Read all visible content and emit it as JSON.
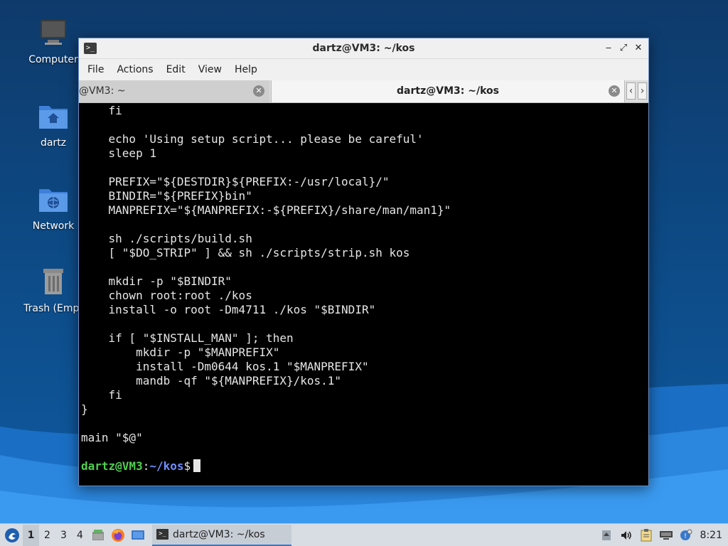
{
  "desktop": {
    "icons": [
      {
        "label": "Computer"
      },
      {
        "label": "dartz"
      },
      {
        "label": "Network"
      },
      {
        "label": "Trash (Empt"
      }
    ]
  },
  "window": {
    "title": "dartz@VM3: ~/kos",
    "app_icon": ">_",
    "controls": {
      "minimize": "‒",
      "maximize": "⤢",
      "close": "✕"
    },
    "menu": [
      "File",
      "Actions",
      "Edit",
      "View",
      "Help"
    ],
    "tabs": [
      {
        "label": "@VM3: ~",
        "active": false
      },
      {
        "label": "dartz@VM3: ~/kos",
        "active": true
      }
    ],
    "tab_close_glyph": "✕",
    "tab_scroll": {
      "left": "‹",
      "right": "›"
    }
  },
  "terminal": {
    "lines": [
      "    fi",
      "",
      "    echo 'Using setup script... please be careful'",
      "    sleep 1",
      "",
      "    PREFIX=\"${DESTDIR}${PREFIX:-/usr/local}/\"",
      "    BINDIR=\"${PREFIX}bin\"",
      "    MANPREFIX=\"${MANPREFIX:-${PREFIX}/share/man/man1}\"",
      "",
      "    sh ./scripts/build.sh",
      "    [ \"$DO_STRIP\" ] && sh ./scripts/strip.sh kos",
      "",
      "    mkdir -p \"$BINDIR\"",
      "    chown root:root ./kos",
      "    install -o root -Dm4711 ./kos \"$BINDIR\"",
      "",
      "    if [ \"$INSTALL_MAN\" ]; then",
      "        mkdir -p \"$MANPREFIX\"",
      "        install -Dm0644 kos.1 \"$MANPREFIX\"",
      "        mandb -qf \"${MANPREFIX}/kos.1\"",
      "    fi",
      "}",
      "",
      "main \"$@\"",
      ""
    ],
    "prompt": {
      "user_host": "dartz@VM3",
      "sep": ":",
      "path": "~/kos",
      "symbol": "$"
    }
  },
  "taskbar": {
    "workspaces": [
      "1",
      "2",
      "3",
      "4"
    ],
    "active_workspace": "1",
    "launchers": [
      "file-manager-icon",
      "firefox-icon",
      "desktop-icon"
    ],
    "task": {
      "icon": ">_",
      "label": "dartz@VM3: ~/kos"
    },
    "tray": [
      "updates-icon",
      "volume-icon",
      "clipboard-icon",
      "network-icon",
      "notification-icon"
    ],
    "clock": "8:21"
  },
  "colors": {
    "prompt_user": "#4fd04f",
    "prompt_path": "#6f8fff",
    "terminal_bg": "#000000",
    "terminal_fg": "#e6e6e6",
    "window_border": "#6a8fc5"
  }
}
